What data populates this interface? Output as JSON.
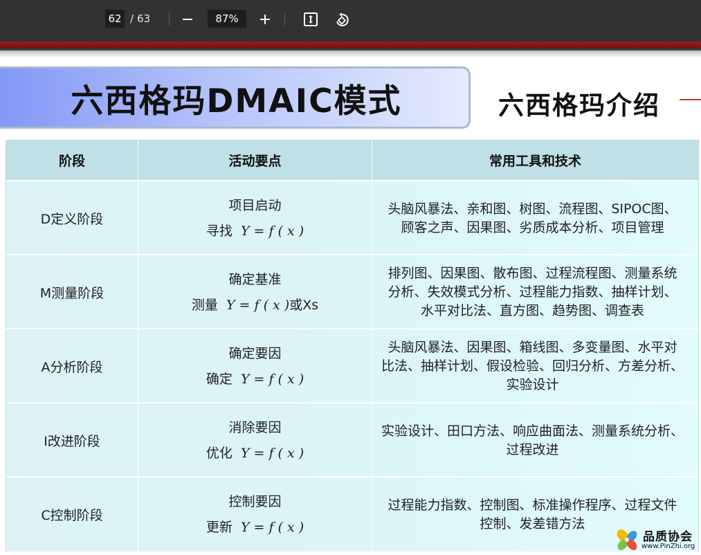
{
  "toolbar": {
    "current_page": "62",
    "page_separator": "/",
    "total_pages": "63",
    "zoom": "87%",
    "zoom_out_icon": "minus-icon",
    "zoom_in_icon": "plus-icon",
    "fit_icon": "fit-to-page-icon",
    "rotate_icon": "rotate-icon"
  },
  "slide": {
    "title": "六西格玛DMAIC模式",
    "subtitle": "六西格玛介绍",
    "accent_color": "#c8392b"
  },
  "table": {
    "headers": [
      "阶段",
      "活动要点",
      "常用工具和技术"
    ],
    "rows": [
      {
        "stage": "D定义阶段",
        "activity": "项目启动",
        "verb": "寻找",
        "formula": "Y = f ( x )",
        "suffix": "",
        "tools": "头脑风暴法、亲和图、树图、流程图、SIPOC图、\n顾客之声、因果图、劣质成本分析、项目管理"
      },
      {
        "stage": "M测量阶段",
        "activity": "确定基准",
        "verb": "测量",
        "formula": "Y = f ( x )",
        "suffix": "或Xs",
        "tools": "排列图、因果图、散布图、过程流程图、测量系统\n分析、失效模式分析、过程能力指数、抽样计划、\n水平对比法、直方图、趋势图、调查表"
      },
      {
        "stage": "A分析阶段",
        "activity": "确定要因",
        "verb": "确定",
        "formula": "Y = f ( x )",
        "suffix": "",
        "tools": "头脑风暴法、因果图、箱线图、多变量图、水平对\n比法、抽样计划、假设检验、回归分析、方差分析、\n实验设计"
      },
      {
        "stage": "I改进阶段",
        "activity": "消除要因",
        "verb": "优化",
        "formula": "Y = f ( x )",
        "suffix": "",
        "tools": "实验设计、田口方法、响应曲面法、测量系统分析、\n过程改进"
      },
      {
        "stage": "C控制阶段",
        "activity": "控制要因",
        "verb": "更新",
        "formula": "Y = f ( x )",
        "suffix": "",
        "tools": "过程能力指数、控制图、标准操作程序、过程文件\n控制、发差错方法"
      }
    ]
  },
  "watermark": {
    "name": "品质协会",
    "url": "www.PinZhi.org",
    "icon": "pinzhi-logo-icon"
  }
}
